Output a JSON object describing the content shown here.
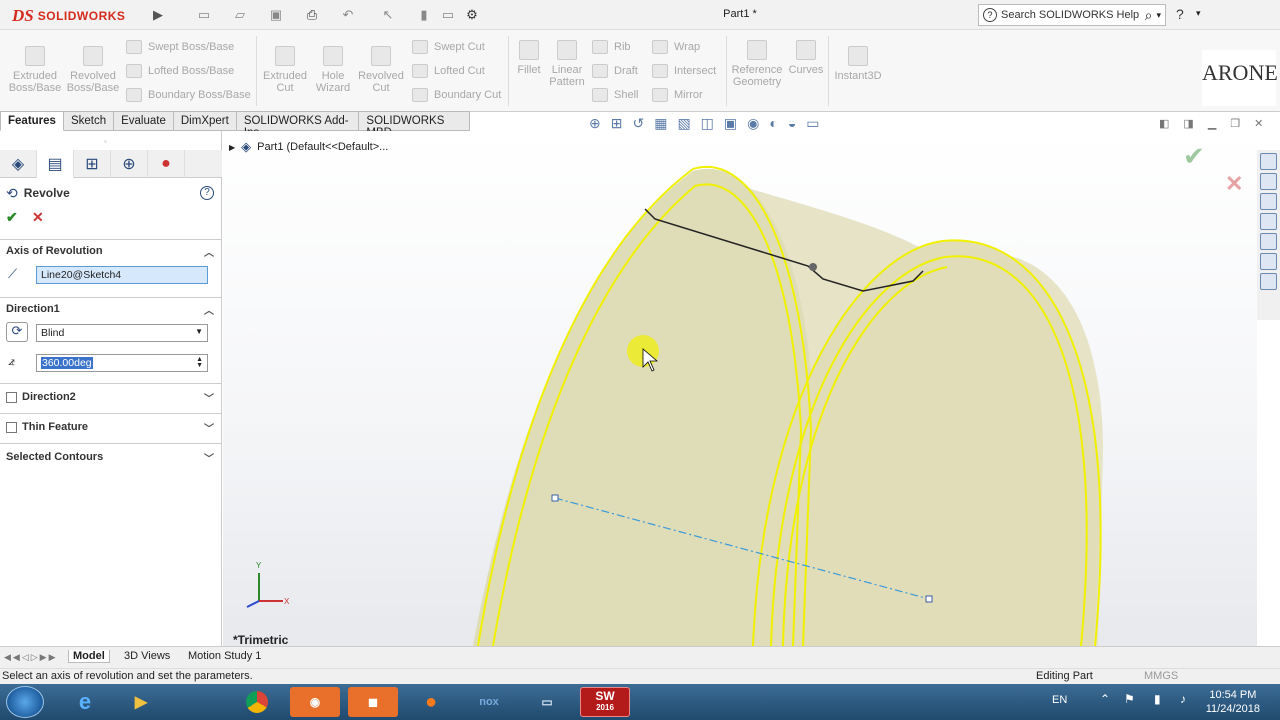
{
  "app": {
    "name": "SOLIDWORKS",
    "logo_mark": "DS",
    "document_title": "Part1 *"
  },
  "title_toolbar": {
    "icons": [
      "new-icon",
      "open-icon",
      "save-icon",
      "print-icon",
      "undo-icon",
      "select-icon",
      "rebuild-icon",
      "options-icon"
    ]
  },
  "search": {
    "label": "Search SOLIDWORKS Help",
    "help_symbol": "?"
  },
  "ribbon": {
    "extruded_boss": "Extruded\nBoss/Base",
    "revolved_boss": "Revolved\nBoss/Base",
    "swept_boss": "Swept Boss/Base",
    "lofted_boss": "Lofted Boss/Base",
    "boundary_boss": "Boundary Boss/Base",
    "extruded_cut": "Extruded\nCut",
    "hole_wizard": "Hole\nWizard",
    "revolved_cut": "Revolved\nCut",
    "swept_cut": "Swept Cut",
    "lofted_cut": "Lofted Cut",
    "boundary_cut": "Boundary Cut",
    "fillet": "Fillet",
    "linear_pattern": "Linear\nPattern",
    "rib": "Rib",
    "draft": "Draft",
    "shell": "Shell",
    "wrap": "Wrap",
    "intersect": "Intersect",
    "mirror": "Mirror",
    "reference_geometry": "Reference\nGeometry",
    "curves": "Curves",
    "instant3d": "Instant3D"
  },
  "brand_text": "ARONE",
  "tabs": [
    "Features",
    "Sketch",
    "Evaluate",
    "DimXpert",
    "SOLIDWORKS Add-Ins",
    "SOLIDWORKS MBD"
  ],
  "active_tab": "Features",
  "tree": {
    "root": "Part1  (Default<<Default>..."
  },
  "property_manager": {
    "title": "Revolve",
    "help": "?",
    "ok": "✔",
    "cancel": "✕",
    "axis_section": "Axis of Revolution",
    "axis_value": "Line20@Sketch4",
    "direction1_section": "Direction1",
    "direction1_type": "Blind",
    "angle_value": "360.00deg",
    "direction2": "Direction2",
    "thin_feature": "Thin Feature",
    "selected_contours": "Selected Contours"
  },
  "viewport": {
    "view_label": "*Trimetric",
    "triad": {
      "x": "X",
      "y": "Y"
    }
  },
  "bottom_tabs": [
    "Model",
    "3D Views",
    "Motion Study 1"
  ],
  "status": {
    "message": "Select an axis of revolution and set the parameters.",
    "mode": "Editing Part",
    "units": "MMGS"
  },
  "taskbar": {
    "lang": "EN",
    "time": "10:54 PM",
    "date": "11/24/2018",
    "sw_badge": "SW",
    "sw_year": "2016"
  },
  "colors": {
    "accent_red": "#d52b1e",
    "model_yellow": "#f0f000",
    "axis_blue": "#3a9ad9",
    "active_blue": "#1f5fa0"
  }
}
